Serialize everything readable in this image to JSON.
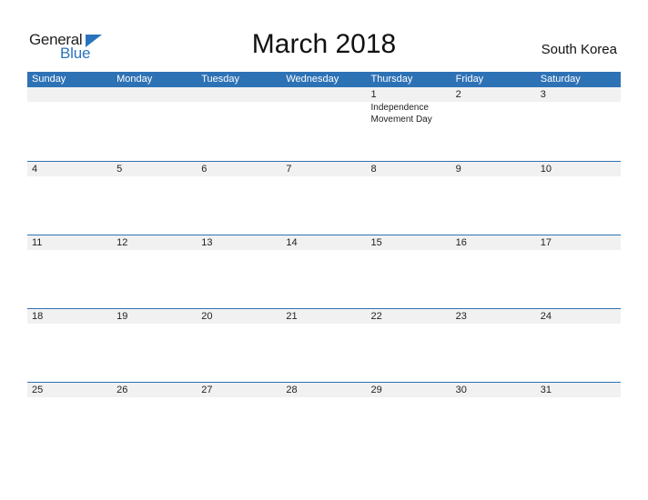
{
  "logo": {
    "word1": "General",
    "word2": "Blue"
  },
  "title": "March 2018",
  "country": "South Korea",
  "colors": {
    "accent": "#2e72b6",
    "strip": "#f1f1f1"
  },
  "weekdays": [
    "Sunday",
    "Monday",
    "Tuesday",
    "Wednesday",
    "Thursday",
    "Friday",
    "Saturday"
  ],
  "weeks": [
    {
      "days": [
        "",
        "",
        "",
        "",
        "1",
        "2",
        "3"
      ],
      "events": [
        "",
        "",
        "",
        "",
        "Independence Movement Day",
        "",
        ""
      ]
    },
    {
      "days": [
        "4",
        "5",
        "6",
        "7",
        "8",
        "9",
        "10"
      ],
      "events": [
        "",
        "",
        "",
        "",
        "",
        "",
        ""
      ]
    },
    {
      "days": [
        "11",
        "12",
        "13",
        "14",
        "15",
        "16",
        "17"
      ],
      "events": [
        "",
        "",
        "",
        "",
        "",
        "",
        ""
      ]
    },
    {
      "days": [
        "18",
        "19",
        "20",
        "21",
        "22",
        "23",
        "24"
      ],
      "events": [
        "",
        "",
        "",
        "",
        "",
        "",
        ""
      ]
    },
    {
      "days": [
        "25",
        "26",
        "27",
        "28",
        "29",
        "30",
        "31"
      ],
      "events": [
        "",
        "",
        "",
        "",
        "",
        "",
        ""
      ]
    }
  ]
}
